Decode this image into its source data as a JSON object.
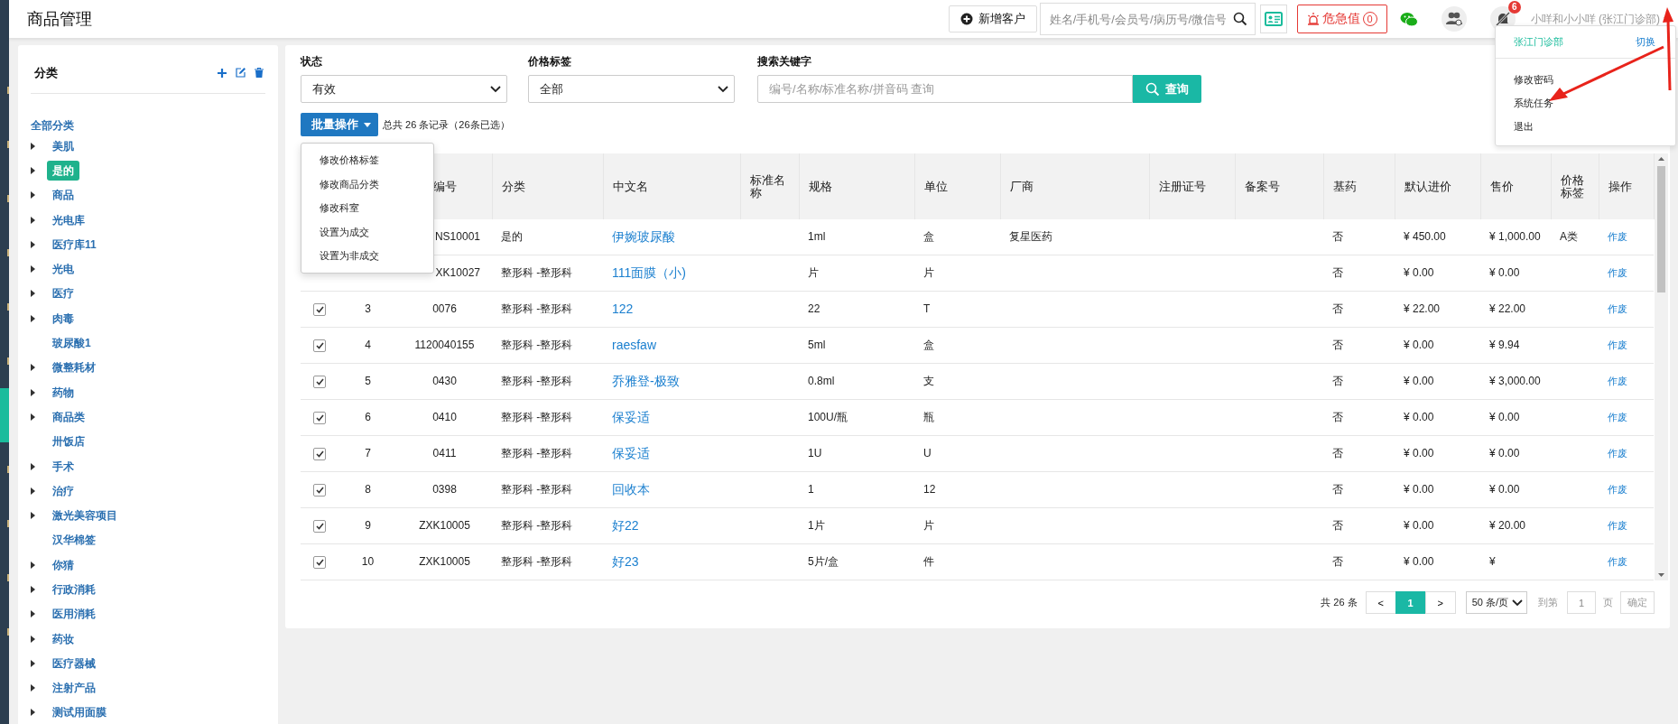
{
  "nav_rail": [
    {
      "selected": false
    },
    {
      "selected": false
    },
    {
      "selected": false
    },
    {
      "selected": false
    },
    {
      "selected": false
    },
    {
      "selected": false
    },
    {
      "selected": true
    },
    {
      "selected": false
    },
    {
      "selected": false
    },
    {
      "selected": false
    },
    {
      "selected": false
    }
  ],
  "header": {
    "title": "商品管理",
    "new_customer_button": "新增客户",
    "search": {
      "placeholder": "姓名/手机号/会员号/病历号/微信号"
    },
    "critical_button": {
      "label": "危急值",
      "count": "0"
    },
    "notification_count": "6",
    "user": "小咩和小小咩 (张江门诊部)",
    "user_menu": {
      "clinic": "张江门诊部",
      "switch_link": "切换",
      "items": [
        "修改密码",
        "系统任务",
        "退出"
      ]
    }
  },
  "category_panel": {
    "title": "分类",
    "tree": {
      "label": "全部分类",
      "children": [
        {
          "label": "美肌",
          "expandable": true,
          "selected": false
        },
        {
          "label": "是的",
          "expandable": true,
          "selected": true
        },
        {
          "label": "商品",
          "expandable": true,
          "selected": false
        },
        {
          "label": "光电库",
          "expandable": true,
          "selected": false
        },
        {
          "label": "医疗库11",
          "expandable": true,
          "selected": false
        },
        {
          "label": "光电",
          "expandable": true,
          "selected": false
        },
        {
          "label": "医疗",
          "expandable": true,
          "selected": false
        },
        {
          "label": "肉毒",
          "expandable": true,
          "selected": false
        },
        {
          "label": "玻尿酸1",
          "expandable": false,
          "selected": false
        },
        {
          "label": "微整耗材",
          "expandable": true,
          "selected": false
        },
        {
          "label": "药物",
          "expandable": true,
          "selected": false
        },
        {
          "label": "商品类",
          "expandable": true,
          "selected": false
        },
        {
          "label": "卅饭店",
          "expandable": false,
          "selected": false
        },
        {
          "label": "手术",
          "expandable": true,
          "selected": false
        },
        {
          "label": "治疗",
          "expandable": true,
          "selected": false
        },
        {
          "label": "激光美容项目",
          "expandable": true,
          "selected": false
        },
        {
          "label": "汉华棉签",
          "expandable": false,
          "selected": false
        },
        {
          "label": "你猜",
          "expandable": true,
          "selected": false
        },
        {
          "label": "行政消耗",
          "expandable": true,
          "selected": false
        },
        {
          "label": "医用消耗",
          "expandable": true,
          "selected": false
        },
        {
          "label": "药妆",
          "expandable": true,
          "selected": false
        },
        {
          "label": "医疗器械",
          "expandable": true,
          "selected": false
        },
        {
          "label": "注射产品",
          "expandable": true,
          "selected": false
        },
        {
          "label": "测试用面膜",
          "expandable": true,
          "selected": false
        }
      ]
    }
  },
  "filters": [
    {
      "kind": "select",
      "label": "状态",
      "value": "有效"
    },
    {
      "kind": "select",
      "label": "价格标签",
      "value": "全部"
    },
    {
      "kind": "search",
      "label": "搜索关键字",
      "placeholder": "编号/名称/标准名称/拼音码 查询",
      "button": "查询"
    }
  ],
  "batch": {
    "button": "批量操作",
    "summary": "总共 26 条记录（26条已选）",
    "menu": [
      "修改价格标签",
      "修改商品分类",
      "修改科室",
      "设置为成交",
      "设置为非成交"
    ]
  },
  "table": {
    "columns": [
      "编号",
      "分类",
      "中文名",
      "标准名称",
      "规格",
      "单位",
      "厂商",
      "注册证号",
      "备案号",
      "基药",
      "默认进价",
      "售价",
      "价格标签",
      "操作"
    ],
    "rows": [
      {
        "code": "NS10001",
        "category": "是的",
        "name": "伊婉玻尿酸",
        "spec": "1ml",
        "unit": "盒",
        "maker": "复星医药",
        "basic": "否",
        "cost": "¥ 450.00",
        "price": "¥ 1,000.00",
        "tag": "A类",
        "action": "作废"
      },
      {
        "code": "XK10027",
        "category": "整形科 -整形科",
        "name": "111面膜（小)",
        "spec": "片",
        "unit": "片",
        "basic": "否",
        "cost": "¥ 0.00",
        "price": "¥ 0.00",
        "action": "作废"
      },
      {
        "checked": true,
        "number": "3",
        "code": "0076",
        "category": "整形科 -整形科",
        "name": "122",
        "spec": "22",
        "unit": "T",
        "basic": "否",
        "cost": "¥ 22.00",
        "price": "¥ 22.00",
        "action": "作废"
      },
      {
        "checked": true,
        "number": "4",
        "code": "1120040155",
        "category": "整形科 -整形科",
        "name": "raesfaw",
        "spec": "5ml",
        "unit": "盒",
        "basic": "否",
        "cost": "¥ 0.00",
        "price": "¥ 9.94",
        "action": "作废"
      },
      {
        "checked": true,
        "number": "5",
        "code": "0430",
        "category": "整形科 -整形科",
        "name": "乔雅登-极致",
        "spec": "0.8ml",
        "unit": "支",
        "basic": "否",
        "cost": "¥ 0.00",
        "price": "¥ 3,000.00",
        "action": "作废"
      },
      {
        "checked": true,
        "number": "6",
        "code": "0410",
        "category": "整形科 -整形科",
        "name": "保妥适",
        "spec": "100U/瓶",
        "unit": "瓶",
        "basic": "否",
        "cost": "¥ 0.00",
        "price": "¥ 0.00",
        "action": "作废"
      },
      {
        "checked": true,
        "number": "7",
        "code": "0411",
        "category": "整形科 -整形科",
        "name": "保妥适",
        "spec": "1U",
        "unit": "U",
        "basic": "否",
        "cost": "¥ 0.00",
        "price": "¥ 0.00",
        "action": "作废"
      },
      {
        "checked": true,
        "number": "8",
        "code": "0398",
        "category": "整形科 -整形科",
        "name": "回收本",
        "spec": "1",
        "unit": "12",
        "basic": "否",
        "cost": "¥ 0.00",
        "price": "¥ 0.00",
        "action": "作废"
      },
      {
        "checked": true,
        "number": "9",
        "code": "ZXK10005",
        "category": "整形科 -整形科",
        "name": "好22",
        "spec": "1片",
        "unit": "片",
        "basic": "否",
        "cost": "¥ 0.00",
        "price": "¥ 20.00",
        "action": "作废"
      },
      {
        "checked": true,
        "number": "10",
        "code": "ZXK10005",
        "category": "整形科 -整形科",
        "name": "好23",
        "spec": "5片/盒",
        "unit": "件",
        "basic": "否",
        "cost": "¥ 0.00",
        "price": "¥",
        "action": "作废"
      }
    ]
  },
  "pagination": {
    "total": "共 26 条",
    "prev": "<",
    "pages": [
      {
        "label": "1",
        "selected": true
      }
    ],
    "next": ">",
    "page_size": "50 条/页",
    "goto_label": "到第",
    "goto_value": "1",
    "page_unit": "页",
    "confirm": "确定"
  }
}
